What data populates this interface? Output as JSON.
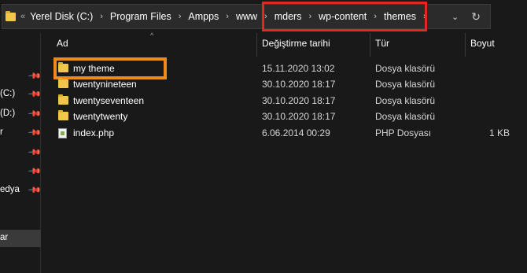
{
  "address_bar": {
    "overflow_indicator": "«",
    "breadcrumbs": [
      "Yerel Disk (C:)",
      "Program Files",
      "Ampps",
      "www",
      "mders",
      "wp-content",
      "themes"
    ],
    "separator": "›",
    "dropdown_glyph": "⌄",
    "refresh_glyph": "↻",
    "highlight_color": "#e32626"
  },
  "sidebar": {
    "items": [
      {
        "label": "",
        "pinned": true
      },
      {
        "label": "(C:)",
        "pinned": true
      },
      {
        "label": "(D:)",
        "pinned": true
      },
      {
        "label": "r",
        "pinned": true
      },
      {
        "label": "",
        "pinned": true
      },
      {
        "label": "",
        "pinned": true
      },
      {
        "label": "edya",
        "pinned": true
      },
      {
        "label": "",
        "pinned": false
      },
      {
        "label": "",
        "pinned": false
      },
      {
        "label": "ar",
        "pinned": false
      }
    ],
    "pin_glyph": "📌"
  },
  "columns": {
    "name": "Ad",
    "date": "Değiştirme tarihi",
    "type": "Tür",
    "size": "Boyut",
    "sort_glyph": "^"
  },
  "files": [
    {
      "name": "my theme",
      "date": "15.11.2020 13:02",
      "type": "Dosya klasörü",
      "size": "",
      "icon": "folder-icon",
      "highlighted": true
    },
    {
      "name": "twentynineteen",
      "date": "30.10.2020 18:17",
      "type": "Dosya klasörü",
      "size": "",
      "icon": "folder-icon",
      "highlighted": false
    },
    {
      "name": "twentyseventeen",
      "date": "30.10.2020 18:17",
      "type": "Dosya klasörü",
      "size": "",
      "icon": "folder-icon",
      "highlighted": false
    },
    {
      "name": "twentytwenty",
      "date": "30.10.2020 18:17",
      "type": "Dosya klasörü",
      "size": "",
      "icon": "folder-icon",
      "highlighted": false
    },
    {
      "name": "index.php",
      "date": "6.06.2014 00:29",
      "type": "PHP Dosyası",
      "size": "1 KB",
      "icon": "php-file-icon",
      "highlighted": false
    }
  ],
  "colors": {
    "background": "#191919",
    "highlight_orange": "#f08a1c",
    "folder": "#f2c54b"
  }
}
